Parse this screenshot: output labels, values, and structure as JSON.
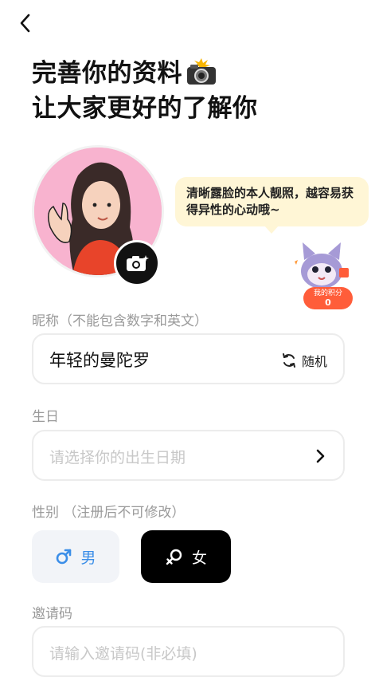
{
  "nav": {
    "back_icon": "chevron-left-icon"
  },
  "title": {
    "line1": "完善你的资料",
    "line2": "让大家更好的了解你",
    "emoji": "camera-flash-icon"
  },
  "avatar": {
    "camera_icon": "camera-icon"
  },
  "tip_bubble": {
    "text": "清晰露脸的本人靓照，越容易获得异性的心动哦~"
  },
  "points_badge": {
    "label": "我的积分",
    "value": "0"
  },
  "nickname": {
    "label": "昵称（不能包含数字和英文）",
    "value": "年轻的曼陀罗",
    "random_label": "随机",
    "random_icon": "refresh-icon"
  },
  "birthday": {
    "label": "生日",
    "placeholder": "请选择你的出生日期",
    "arrow_icon": "chevron-right-icon"
  },
  "gender": {
    "label": "性别",
    "note": "（注册后不可修改）",
    "options": [
      {
        "label": "男",
        "icon": "male-symbol-icon",
        "color": "#3b8ee8",
        "selected": false
      },
      {
        "label": "女",
        "icon": "female-symbol-icon",
        "color": "#ffffff",
        "selected": true
      }
    ]
  },
  "invite": {
    "label": "邀请码",
    "placeholder": "请输入邀请码(非必填)"
  }
}
